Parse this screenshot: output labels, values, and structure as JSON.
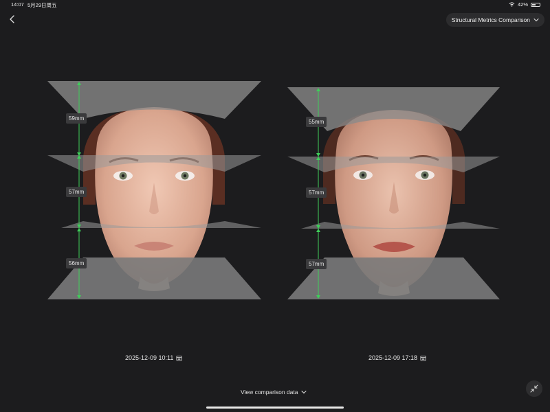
{
  "status_bar": {
    "time": "14:07",
    "date": "5月29日周五",
    "battery": "42%"
  },
  "header": {
    "back_icon": "chevron-left-icon",
    "dropdown_label": "Structural Metrics Comparison"
  },
  "comparisons": [
    {
      "measurements": [
        "59mm",
        "57mm",
        "56mm"
      ],
      "timestamp": "2025-12-09 10:11"
    },
    {
      "measurements": [
        "55mm",
        "57mm",
        "57mm"
      ],
      "timestamp": "2025-12-09 17:18"
    }
  ],
  "footer": {
    "view_data_label": "View comparison data"
  },
  "colors": {
    "background": "#1c1c1e",
    "measure_line": "#3fcf5a",
    "plane_fill": "#8a8a8a"
  }
}
